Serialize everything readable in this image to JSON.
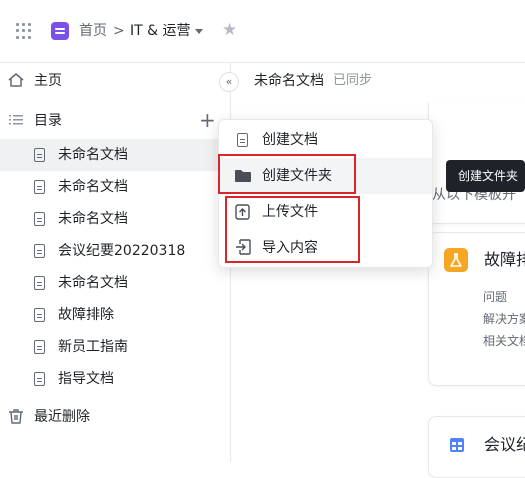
{
  "breadcrumb": {
    "home": "首页",
    "separator": ">",
    "workspace": "IT & 运营"
  },
  "sidebar": {
    "home_label": "主页",
    "catalog_label": "目录",
    "items": [
      {
        "label": "未命名文档"
      },
      {
        "label": "未命名文档"
      },
      {
        "label": "未命名文档"
      },
      {
        "label": "会议纪要20220318"
      },
      {
        "label": "未命名文档"
      },
      {
        "label": "故障排除"
      },
      {
        "label": "新员工指南"
      },
      {
        "label": "指导文档"
      }
    ],
    "recent_deleted_label": "最近删除"
  },
  "doc_header": {
    "title": "未命名文档",
    "status": "已同步"
  },
  "content": {
    "template_hint": "从以下模板开",
    "card1": {
      "title": "故障排",
      "lines": [
        "问题",
        "解决方案",
        "相关文档"
      ]
    },
    "card2": {
      "title": "会议纪"
    }
  },
  "menu": {
    "create_doc": "创建文档",
    "create_folder": "创建文件夹",
    "upload_file": "上传文件",
    "import_content": "导入内容"
  },
  "tooltip": {
    "text": "创建文件夹"
  },
  "colors": {
    "brand": "#7b4fe9",
    "highlight_box": "#d8262b",
    "active_row": "#f0f1f3"
  }
}
